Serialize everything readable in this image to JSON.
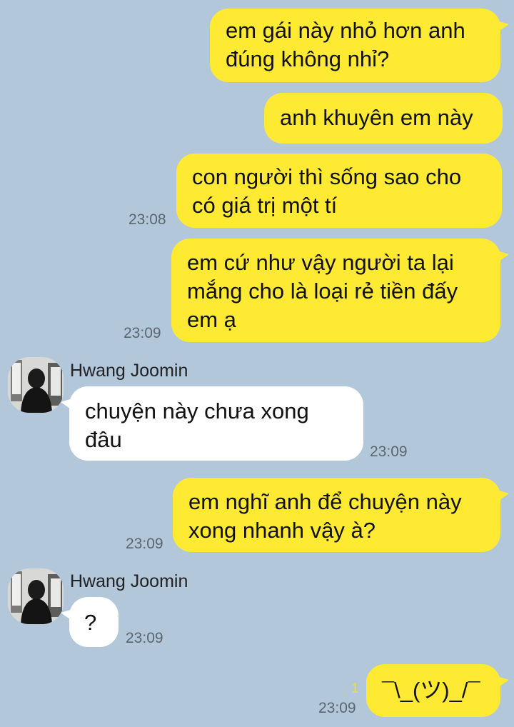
{
  "contact": {
    "name": "Hwang Joomin"
  },
  "messages": [
    {
      "dir": "out",
      "text": "em gái này nhỏ hơn anh\nđúng không nhỉ?",
      "time": ""
    },
    {
      "dir": "out",
      "text": "anh khuyên em này",
      "time": ""
    },
    {
      "dir": "out",
      "text": "con người thì sống sao cho\ncó giá trị một tí",
      "time": "23:08"
    },
    {
      "dir": "out",
      "text": "em cứ như vậy người ta lại\nmắng cho là loại rẻ tiền đấy\nem ạ",
      "time": "23:09"
    },
    {
      "dir": "in",
      "sender": "Hwang Joomin",
      "text": "chuyện này chưa xong\nđâu",
      "time": "23:09"
    },
    {
      "dir": "out",
      "text": "em nghĩ anh để chuyện này\nxong nhanh vậy à?",
      "time": "23:09"
    },
    {
      "dir": "in",
      "sender": "Hwang Joomin",
      "text": "?",
      "time": "23:09"
    },
    {
      "dir": "out",
      "text": "¯\\_(ツ)_/¯",
      "time": "23:09",
      "unread": "1"
    }
  ],
  "colors": {
    "background": "#b2c7da",
    "outgoing_bubble": "#ffea33",
    "incoming_bubble": "#ffffff"
  },
  "icons": {
    "avatar": "profile-photo-avatar"
  }
}
